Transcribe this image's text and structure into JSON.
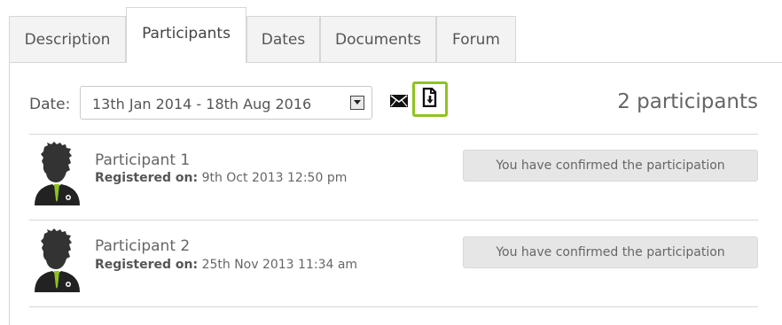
{
  "tabs": [
    {
      "label": "Description",
      "active": false
    },
    {
      "label": "Participants",
      "active": true
    },
    {
      "label": "Dates",
      "active": false
    },
    {
      "label": "Documents",
      "active": false
    },
    {
      "label": "Forum",
      "active": false
    }
  ],
  "filter": {
    "date_label": "Date:",
    "date_value": "13th Jan 2014 - 18th Aug 2016",
    "mail_icon": "envelope-icon",
    "export_icon": "file-download-icon",
    "accent_color": "#8fc31f"
  },
  "count_text": "2 participants",
  "participants": [
    {
      "name": "Participant 1",
      "registered_label": "Registered on:",
      "registered_value": "9th Oct 2013 12:50 pm",
      "status": "You have confirmed the participation"
    },
    {
      "name": "Participant 2",
      "registered_label": "Registered on:",
      "registered_value": "25th Nov 2013 11:34 am",
      "status": "You have confirmed the participation"
    }
  ]
}
